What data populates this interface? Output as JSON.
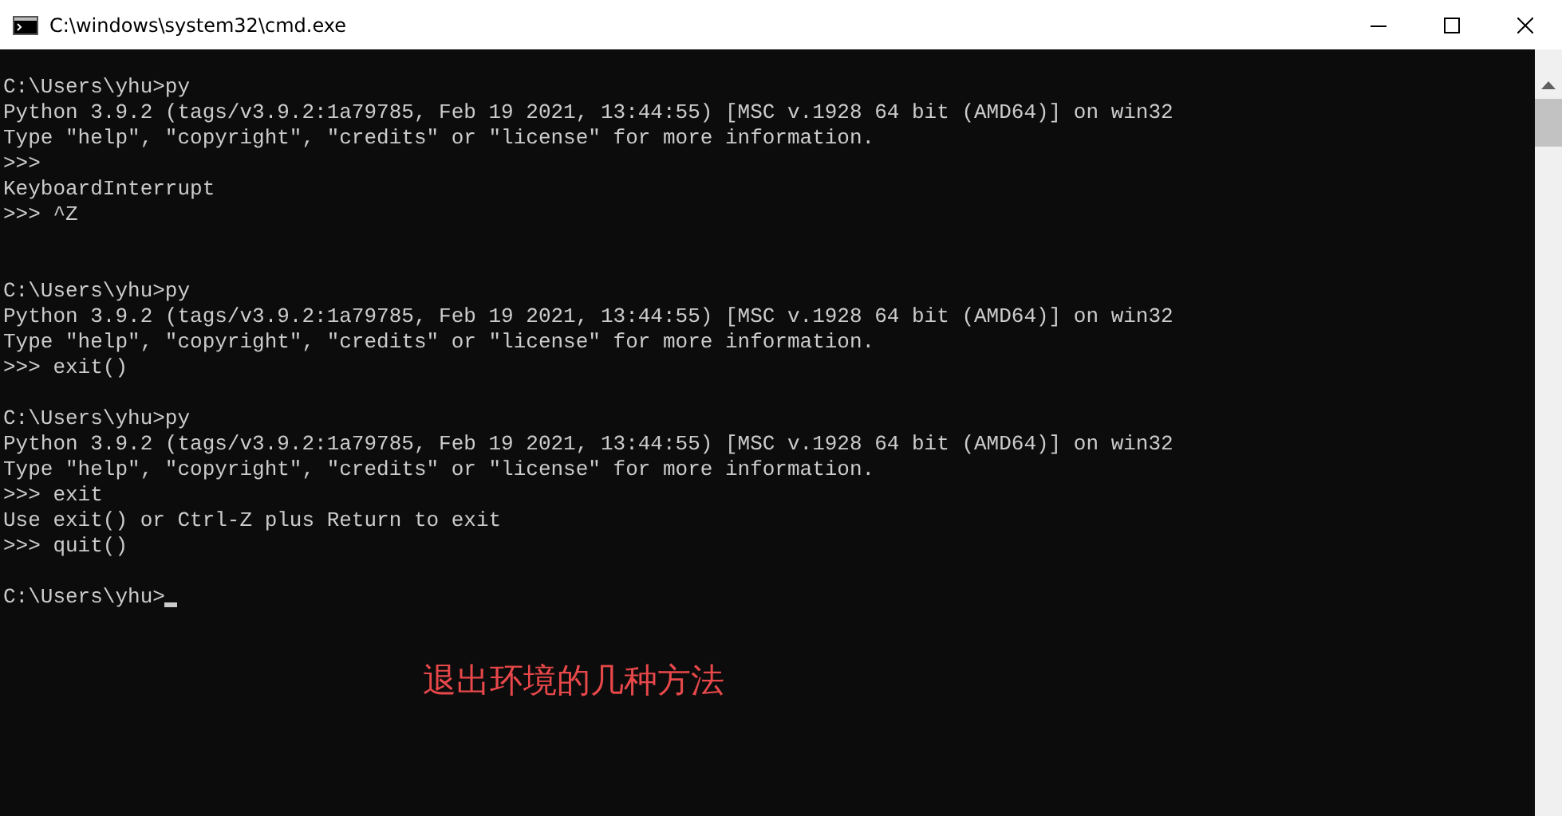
{
  "window": {
    "title": "C:\\windows\\system32\\cmd.exe"
  },
  "console": {
    "lines": [
      {
        "kind": "text",
        "text": "C:\\Users\\yhu>py"
      },
      {
        "kind": "text",
        "text": "Python 3.9.2 (tags/v3.9.2:1a79785, Feb 19 2021, 13:44:55) [MSC v.1928 64 bit (AMD64)] on win32"
      },
      {
        "kind": "text",
        "text": "Type \"help\", \"copyright\", \"credits\" or \"license\" for more information."
      },
      {
        "kind": "text",
        "text": ">>>"
      },
      {
        "kind": "text",
        "text": "KeyboardInterrupt"
      },
      {
        "kind": "text",
        "text": ">>> ^Z"
      },
      {
        "kind": "blank"
      },
      {
        "kind": "blank"
      },
      {
        "kind": "text",
        "text": "C:\\Users\\yhu>py"
      },
      {
        "kind": "text",
        "text": "Python 3.9.2 (tags/v3.9.2:1a79785, Feb 19 2021, 13:44:55) [MSC v.1928 64 bit (AMD64)] on win32"
      },
      {
        "kind": "text",
        "text": "Type \"help\", \"copyright\", \"credits\" or \"license\" for more information."
      },
      {
        "kind": "text",
        "text": ">>> exit()"
      },
      {
        "kind": "blank"
      },
      {
        "kind": "text",
        "text": "C:\\Users\\yhu>py"
      },
      {
        "kind": "text",
        "text": "Python 3.9.2 (tags/v3.9.2:1a79785, Feb 19 2021, 13:44:55) [MSC v.1928 64 bit (AMD64)] on win32"
      },
      {
        "kind": "text",
        "text": "Type \"help\", \"copyright\", \"credits\" or \"license\" for more information."
      },
      {
        "kind": "text",
        "text": ">>> exit"
      },
      {
        "kind": "text",
        "text": "Use exit() or Ctrl-Z plus Return to exit"
      },
      {
        "kind": "text",
        "text": ">>> quit()"
      },
      {
        "kind": "blank"
      },
      {
        "kind": "prompt",
        "text": "C:\\Users\\yhu>",
        "cursor": true
      }
    ]
  },
  "annotation": "退出环境的几种方法"
}
